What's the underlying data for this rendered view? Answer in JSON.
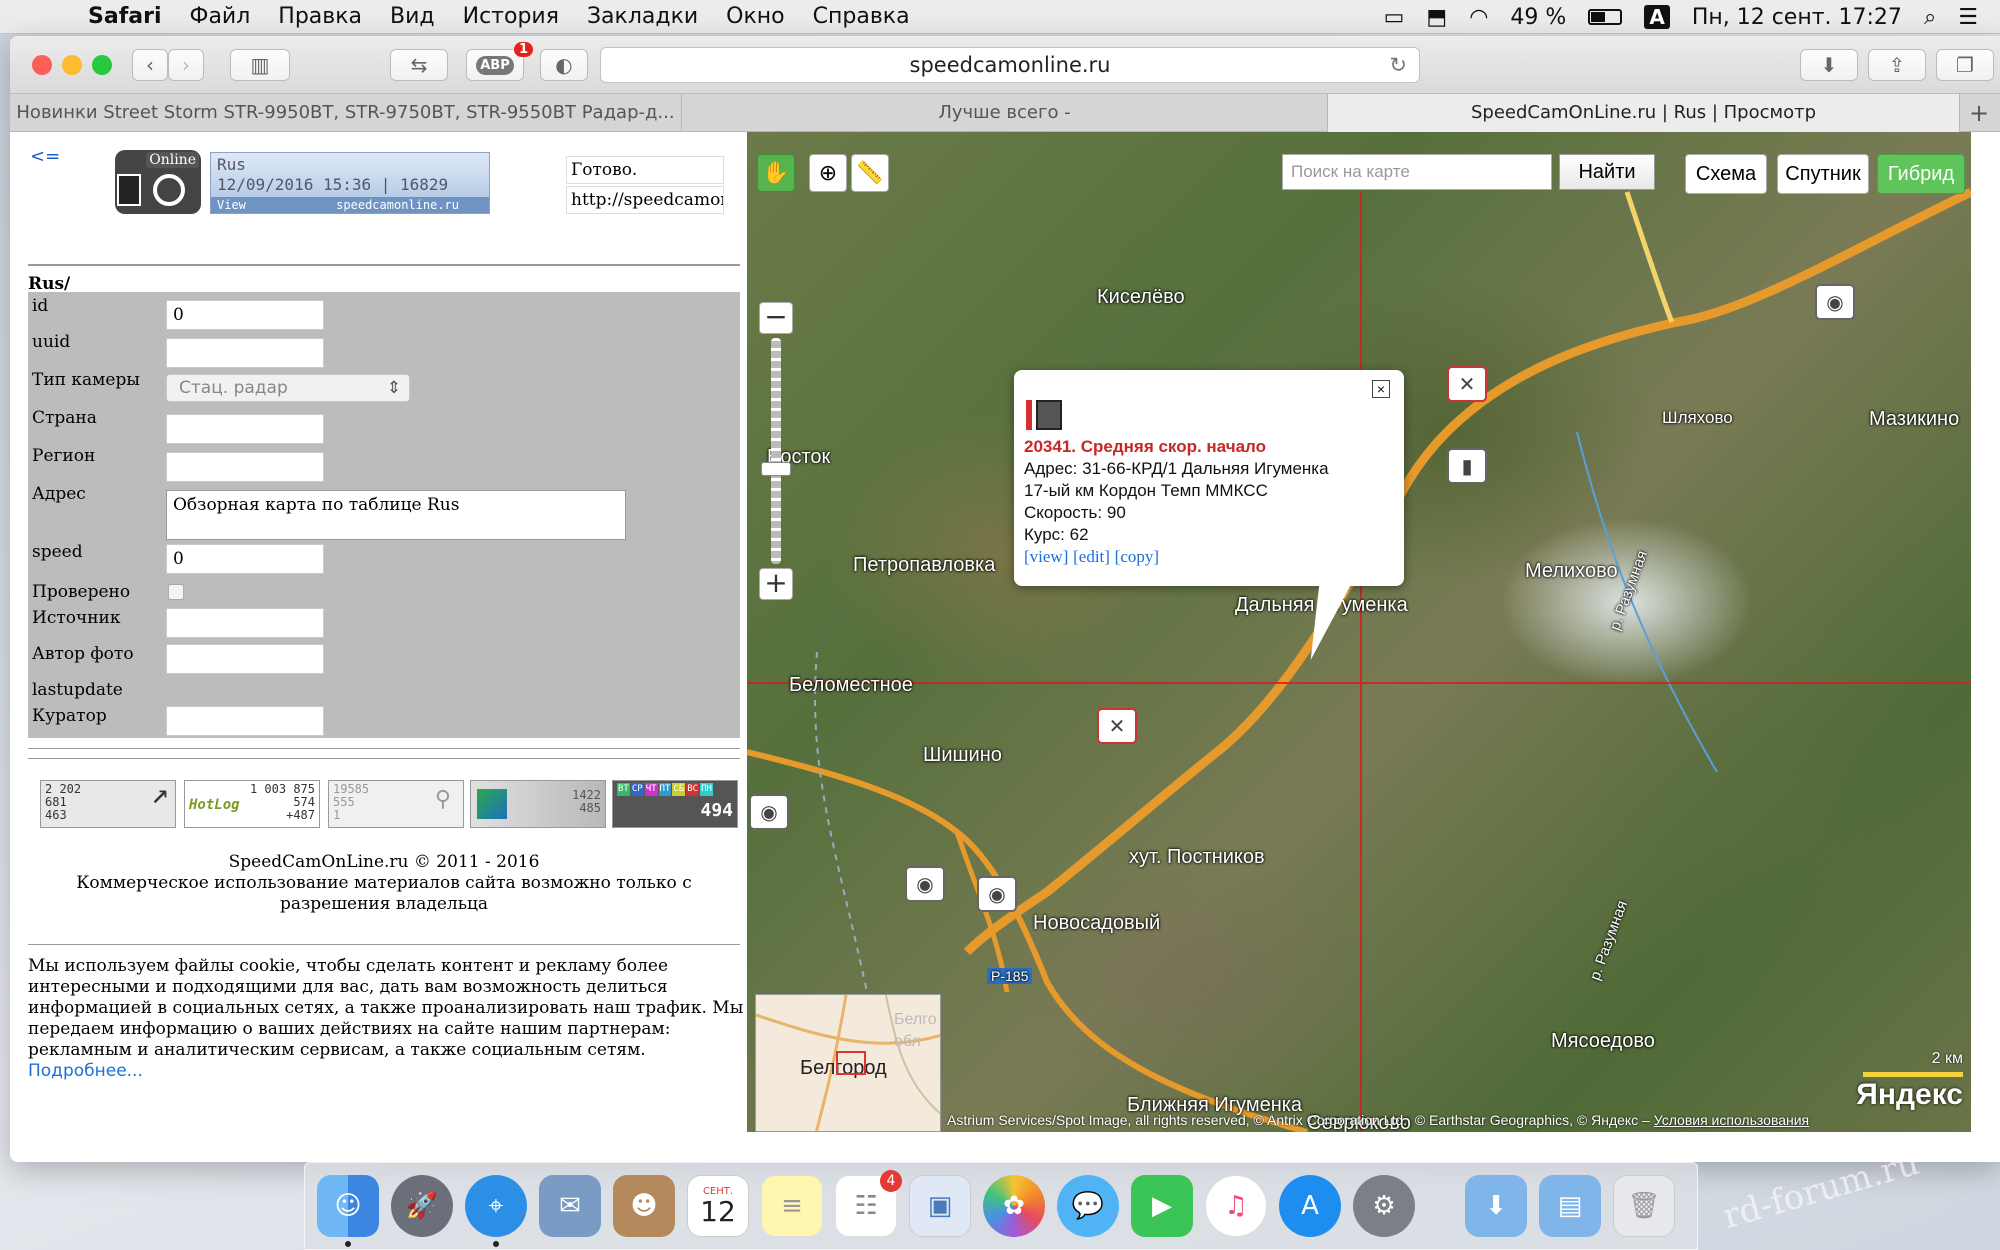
{
  "menubar": {
    "app_name": "Safari",
    "items": [
      "Файл",
      "Правка",
      "Вид",
      "История",
      "Закладки",
      "Окно",
      "Справка"
    ],
    "battery_percent": "49 %",
    "battery_level": 0.49,
    "input_source": "A",
    "datetime": "Пн, 12 сент.  17:27"
  },
  "browser": {
    "url": "speedcamonline.ru",
    "adblock_badge": "1",
    "adblock_label": "ABP",
    "tabs": [
      {
        "title": "Новинки Street Storm STR-9950BT, STR-9750BT, STR-9550BT Радар-д...",
        "active": false
      },
      {
        "title": "Лучше всего -",
        "active": false
      },
      {
        "title": "SpeedCamOnLine.ru | Rus | Просмотр",
        "active": true
      }
    ],
    "new_tab_label": "+"
  },
  "page": {
    "back_link": "<=",
    "logo_badge": "Online",
    "banner": {
      "line1": "Rus",
      "line2": "12/09/2016 15:36 | 16829",
      "footer_left": "View",
      "footer_right": "speedcamonline.ru"
    },
    "status": "Готово.",
    "status_url": "http://speedcamon",
    "section_title": "Rus/",
    "form": {
      "id_label": "id",
      "id_value": "0",
      "uuid_label": "uuid",
      "uuid_value": "",
      "camera_type_label": "Тип камеры",
      "camera_type_value": "Стац. радар",
      "country_label": "Страна",
      "country_value": "",
      "region_label": "Регион",
      "region_value": "",
      "address_label": "Адрес",
      "address_value": "Обзорная карта по таблице Rus",
      "speed_label": "speed",
      "speed_value": "0",
      "verified_label": "Проверено",
      "verified_checked": false,
      "source_label": "Источник",
      "source_value": "",
      "photo_author_label": "Автор фото",
      "photo_author_value": "",
      "lastupdate_label": "lastupdate",
      "curator_label": "Куратор",
      "curator_value": ""
    },
    "counters": [
      {
        "name": "counter-liveinternet",
        "lines": [
          "2 202",
          "681",
          "463"
        ]
      },
      {
        "name": "counter-hotlog",
        "lines": [
          "1 003 875",
          "574",
          "+487"
        ],
        "brand": "HotLog"
      },
      {
        "name": "counter-stats",
        "lines": [
          "19585",
          "555",
          "1"
        ]
      },
      {
        "name": "counter-chart",
        "lines": [
          "1422",
          "485"
        ]
      },
      {
        "name": "counter-weekday",
        "days": [
          "ВТ",
          "СР",
          "ЧТ",
          "ПТ",
          "СБ",
          "ВС",
          "ПН"
        ],
        "total": "494"
      }
    ],
    "copyright_line1": "SpeedCamOnLine.ru © 2011 - 2016",
    "copyright_line2": "Коммерческое использование материалов сайта возможно только с разрешения владельца",
    "cookie_text": "Мы используем файлы cookie, чтобы сделать контент и рекламу более интересными и подходящими для вас, дать вам возможность делиться информацией в социальных сетях, а также проанализировать наш трафик. Мы передаем информацию о ваших действиях на сайте нашим партнерам: рекламным и аналитическим сервисам, а также социальным сетям.",
    "cookie_more": "Подробнее..."
  },
  "map": {
    "search_placeholder": "Поиск на карте",
    "search_button": "Найти",
    "type_buttons": [
      {
        "label": "Схема",
        "active": false
      },
      {
        "label": "Спутник",
        "active": false
      },
      {
        "label": "Гибрид",
        "active": true
      }
    ],
    "zoom_level_fraction": 0.55,
    "places": [
      "Киселёво",
      "Шляхово",
      "Мазикино",
      "Восток",
      "Петропавловка",
      "Мелихово",
      "Дальняя Игуменка",
      "Беломестное",
      "Шишино",
      "хут. Постников",
      "Новосадовый",
      "Мясоедово",
      "Ближняя Игуменка",
      "Севрюково",
      "р. Разумная",
      "р. Разумная",
      "Р-185"
    ],
    "balloon": {
      "title": "20341. Средняя скор. начало",
      "address": "Адрес: 31-66-КРД/1 Дальняя Игуменка",
      "detail": "17-ый км Кордон Темп ММКСС",
      "speed": "Скорость: 90",
      "course": "Курс: 62",
      "link_view": "[view]",
      "link_edit": "[edit]",
      "link_copy": "[copy]",
      "close": "×"
    },
    "minimap_city": "Белгород",
    "minimap_faded": "Белго обл",
    "scale_label": "2 км",
    "brand": "Яндекс",
    "attribution": "Astrium Services/Spot Image, all rights reserved, © Antrix Corporation Ltd., © Earthstar Geographics, © Яндекс –",
    "terms_link": "Условия использования"
  },
  "dock": {
    "calendar_month": "СЕНТ.",
    "calendar_day": "12",
    "reminders_badge": "4",
    "apps": [
      "Finder",
      "Launchpad",
      "Safari",
      "Mail",
      "Contacts",
      "Calendar",
      "Notes",
      "Reminders",
      "Preview",
      "Photos",
      "Messages",
      "FaceTime",
      "iTunes",
      "App Store",
      "System Preferences",
      "Downloads",
      "Documents",
      "Trash"
    ]
  },
  "watermark": "rd-forum.ru"
}
